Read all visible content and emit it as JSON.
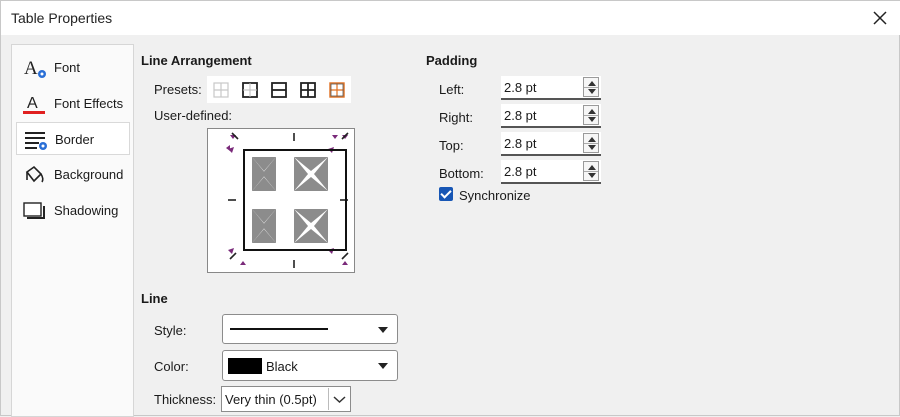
{
  "window": {
    "title": "Table Properties"
  },
  "sidebar": {
    "items": [
      {
        "label": "Font",
        "icon": "font-icon"
      },
      {
        "label": "Font Effects",
        "icon": "font-effects-icon"
      },
      {
        "label": "Border",
        "icon": "border-icon",
        "active": true
      },
      {
        "label": "Background",
        "icon": "background-icon"
      },
      {
        "label": "Shadowing",
        "icon": "shadowing-icon"
      }
    ]
  },
  "line_arrangement": {
    "heading": "Line Arrangement",
    "presets_label": "Presets:",
    "user_defined_label": "User-defined:"
  },
  "line": {
    "heading": "Line",
    "style_label": "Style:",
    "color_label": "Color:",
    "color_value": "Black",
    "color_swatch": "#000000",
    "thickness_label": "Thickness:",
    "thickness_value": "Very thin (0.5pt)"
  },
  "padding": {
    "heading": "Padding",
    "left_label": "Left:",
    "left_value": "2.8 pt",
    "right_label": "Right:",
    "right_value": "2.8 pt",
    "top_label": "Top:",
    "top_value": "2.8 pt",
    "bottom_label": "Bottom:",
    "bottom_value": "2.8 pt",
    "synchronize_label": "Synchronize",
    "synchronize_checked": true
  },
  "colors": {
    "accent": "#1756b5",
    "arrow_marker": "#7a2a7a"
  }
}
